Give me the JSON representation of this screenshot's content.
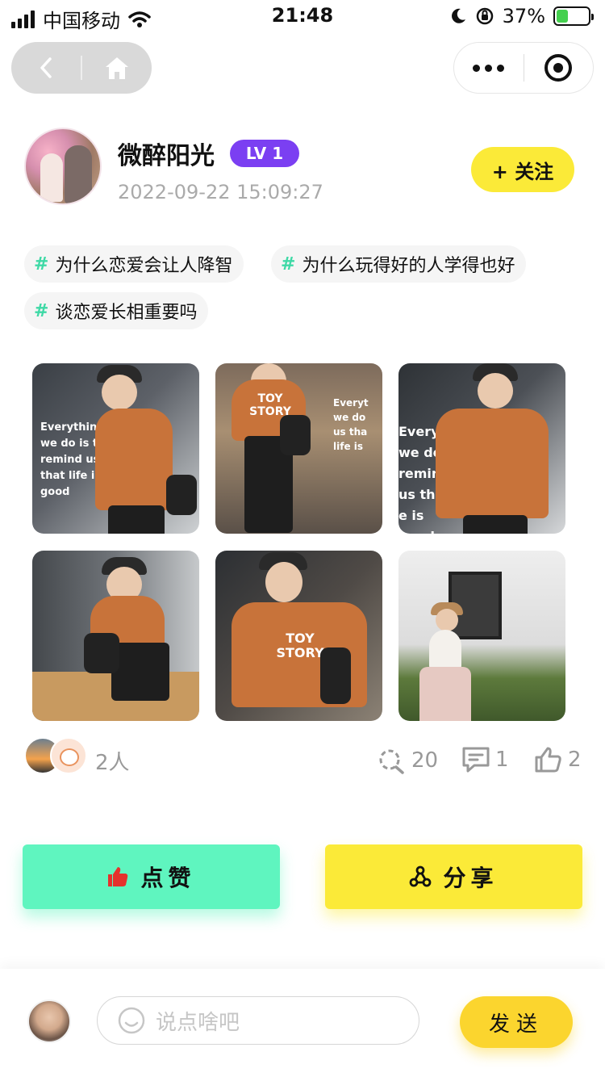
{
  "status_bar": {
    "carrier": "中国移动",
    "time": "21:48",
    "battery_percent": "37%",
    "battery_level": 0.37
  },
  "nav": {
    "back_icon": "chevron-left-icon",
    "home_icon": "home-icon",
    "more_icon": "more-dots-icon",
    "close_icon": "target-circle-icon"
  },
  "author": {
    "name": "微醉阳光",
    "level": "LV 1",
    "date": "2022-09-22 15:09:27",
    "follow_label": "+ 关注"
  },
  "topics": [
    {
      "hash": "#",
      "label": "为什么恋爱会让人降智"
    },
    {
      "hash": "#",
      "label": "为什么玩得好的人学得也好"
    },
    {
      "hash": "#",
      "label": "谈恋爱长相重要吗"
    }
  ],
  "photos": [
    {
      "text": "Everything we do is to remind us that life is good"
    },
    {
      "text": "TOY STORY"
    },
    {
      "text": "Everything we do is remind us that e is good"
    },
    {
      "text": ""
    },
    {
      "text": "TOY STORY"
    },
    {
      "text": ""
    }
  ],
  "meta": {
    "viewers_count": "2人",
    "views": "20",
    "comments": "1",
    "likes": "2"
  },
  "actions": {
    "like_label": "点赞",
    "share_label": "分享"
  },
  "comment_bar": {
    "placeholder": "说点啥吧",
    "send_label": "发送"
  },
  "colors": {
    "accent_yellow": "#fbea38",
    "accent_green": "#5ff5bf",
    "level_purple": "#7b3ff2",
    "hash_green": "#3fd9a6"
  }
}
